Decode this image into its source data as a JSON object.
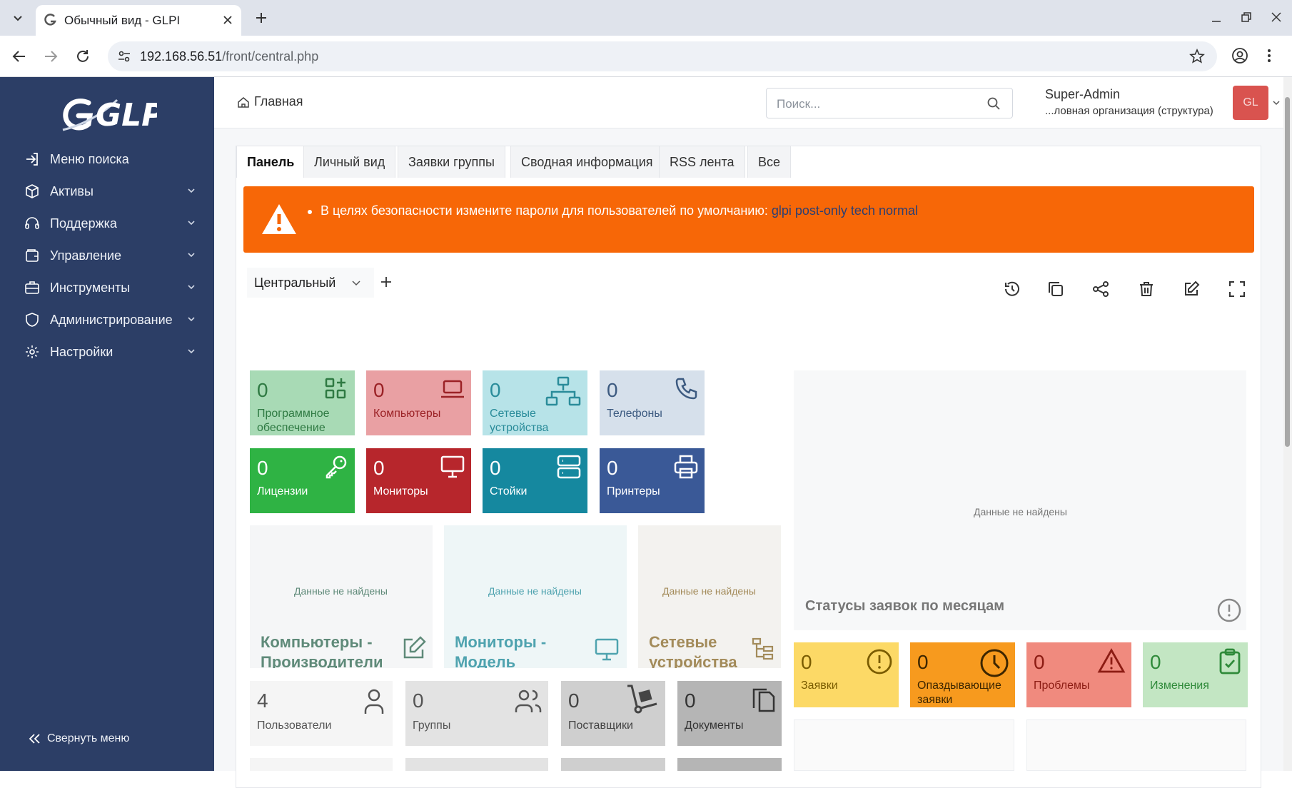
{
  "browser": {
    "tab_title": "Обычный вид - GLPI",
    "url_host": "192.168.56.51",
    "url_path": "/front/central.php"
  },
  "sidebar": {
    "logo_text": "GLPI",
    "items": [
      {
        "label": "Меню поиска",
        "icon": "sign-in-icon",
        "has_children": false
      },
      {
        "label": "Активы",
        "icon": "box-icon",
        "has_children": true
      },
      {
        "label": "Поддержка",
        "icon": "headset-icon",
        "has_children": true
      },
      {
        "label": "Управление",
        "icon": "wallet-icon",
        "has_children": true
      },
      {
        "label": "Инструменты",
        "icon": "briefcase-icon",
        "has_children": true
      },
      {
        "label": "Администрирование",
        "icon": "shield-icon",
        "has_children": true
      },
      {
        "label": "Настройки",
        "icon": "gear-icon",
        "has_children": true
      }
    ],
    "collapse_label": "Свернуть меню"
  },
  "header": {
    "breadcrumb": "Главная",
    "search_placeholder": "Поиск...",
    "user_name": "Super-Admin",
    "user_entity": "...ловная организация (структура)",
    "avatar_initials": "GL"
  },
  "tabs": [
    {
      "label": "Панель",
      "active": true
    },
    {
      "label": "Личный вид",
      "active": false
    },
    {
      "label": "Заявки группы",
      "active": false
    },
    {
      "label": "Сводная информация",
      "active": false
    },
    {
      "label": "RSS лента",
      "active": false
    },
    {
      "label": "Все",
      "active": false
    }
  ],
  "alert": {
    "message": "В целях безопасности измените пароли для пользователей по умолчанию:",
    "links": "glpi post-only tech normal"
  },
  "dashboard": {
    "selected": "Центральный",
    "tiles": [
      {
        "num": "0",
        "label": "Программное обеспечение",
        "icon": "apps-icon",
        "bg": "#a8dab5",
        "fg": "#2f7a43"
      },
      {
        "num": "0",
        "label": "Компьютеры",
        "icon": "laptop-icon",
        "bg": "#e9a0a3",
        "fg": "#9b2226"
      },
      {
        "num": "0",
        "label": "Сетевые устройства",
        "icon": "network-icon",
        "bg": "#b7e3e8",
        "fg": "#2a8c9a"
      },
      {
        "num": "0",
        "label": "Телефоны",
        "icon": "phone-icon",
        "bg": "#d6e0eb",
        "fg": "#3c5a80"
      },
      {
        "num": "0",
        "label": "Лицензии",
        "icon": "key-icon",
        "bg": "#2fb344",
        "fg": "#ffffff"
      },
      {
        "num": "0",
        "label": "Мониторы",
        "icon": "monitor-icon",
        "bg": "#b7262c",
        "fg": "#ffffff"
      },
      {
        "num": "0",
        "label": "Стойки",
        "icon": "server-icon",
        "bg": "#15889f",
        "fg": "#ffffff"
      },
      {
        "num": "0",
        "label": "Принтеры",
        "icon": "printer-icon",
        "bg": "#3a5997",
        "fg": "#ffffff"
      }
    ],
    "charts": [
      {
        "title": "Компьютеры - Производители",
        "nodata": "Данные не найдены",
        "icon": "edit-icon"
      },
      {
        "title": "Мониторы - Модель",
        "nodata": "Данные не найдены",
        "icon": "monitor-icon"
      },
      {
        "title": "Сетевые устройства",
        "nodata": "Данные не найдены",
        "icon": "tree-icon"
      }
    ],
    "bottom_tiles": [
      {
        "num": "4",
        "label": "Пользователи",
        "icon": "user-icon"
      },
      {
        "num": "0",
        "label": "Группы",
        "icon": "users-icon"
      },
      {
        "num": "0",
        "label": "Поставщики",
        "icon": "dolly-icon"
      },
      {
        "num": "0",
        "label": "Документы",
        "icon": "files-icon"
      }
    ],
    "big_chart": {
      "title": "Статусы заявок по месяцам",
      "nodata": "Данные не найдены"
    },
    "ticket_tiles": [
      {
        "num": "0",
        "label": "Заявки",
        "icon": "alert-circle-icon"
      },
      {
        "num": "0",
        "label": "Опаздывающие заявки",
        "icon": "clock-icon"
      },
      {
        "num": "0",
        "label": "Проблемы",
        "icon": "warning-icon"
      },
      {
        "num": "0",
        "label": "Изменения",
        "icon": "clipboard-check-icon"
      }
    ]
  }
}
